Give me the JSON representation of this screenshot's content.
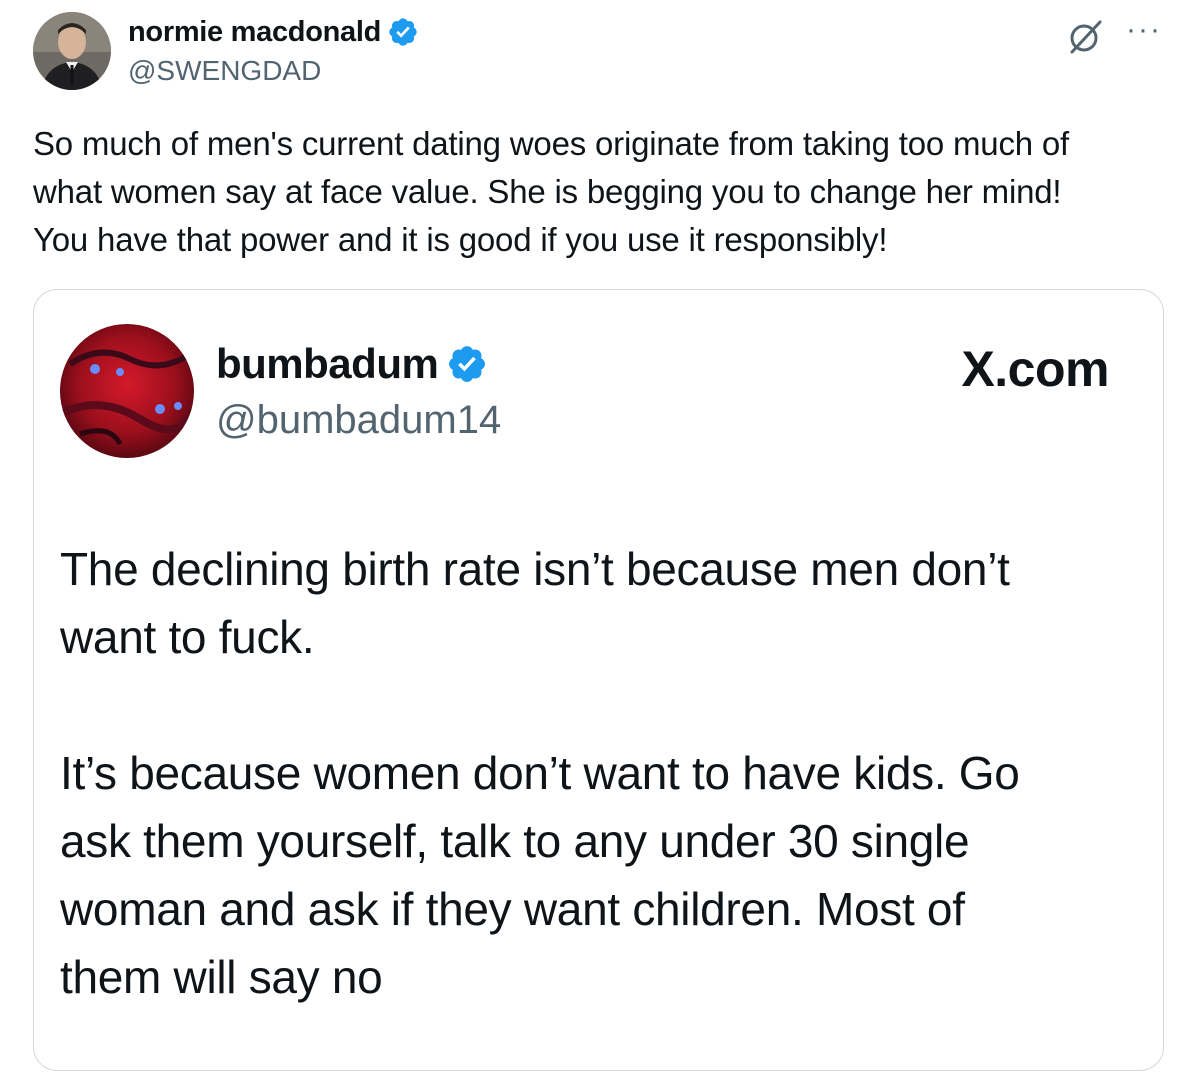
{
  "author": {
    "display_name": "normie macdonald",
    "handle": "@SWENGDAD"
  },
  "icons": {
    "verified": "verified-badge-icon",
    "grok": "grok-icon",
    "more": "more-options-icon"
  },
  "tweet_text_lines": [
    "So much of men's current dating woes originate from taking too much of",
    "what women say at face value. She is begging you to change her mind!",
    "You have that power and it is good if you use it responsibly!"
  ],
  "quote": {
    "display_name": "bumbadum",
    "handle": "@bumbadum14",
    "site": "X.com",
    "paragraph1_lines": [
      "The declining birth rate isn’t because men don’t",
      "want to fuck."
    ],
    "paragraph2_lines": [
      "It’s because women don’t want to have kids. Go",
      "ask them yourself, talk to any under 30 single",
      "woman and ask if they want children. Most of",
      "them will say no"
    ]
  },
  "colors": {
    "text_primary": "#0f1419",
    "text_secondary": "#536471",
    "verified_blue": "#1d9bf0",
    "border": "#cfd9de"
  }
}
